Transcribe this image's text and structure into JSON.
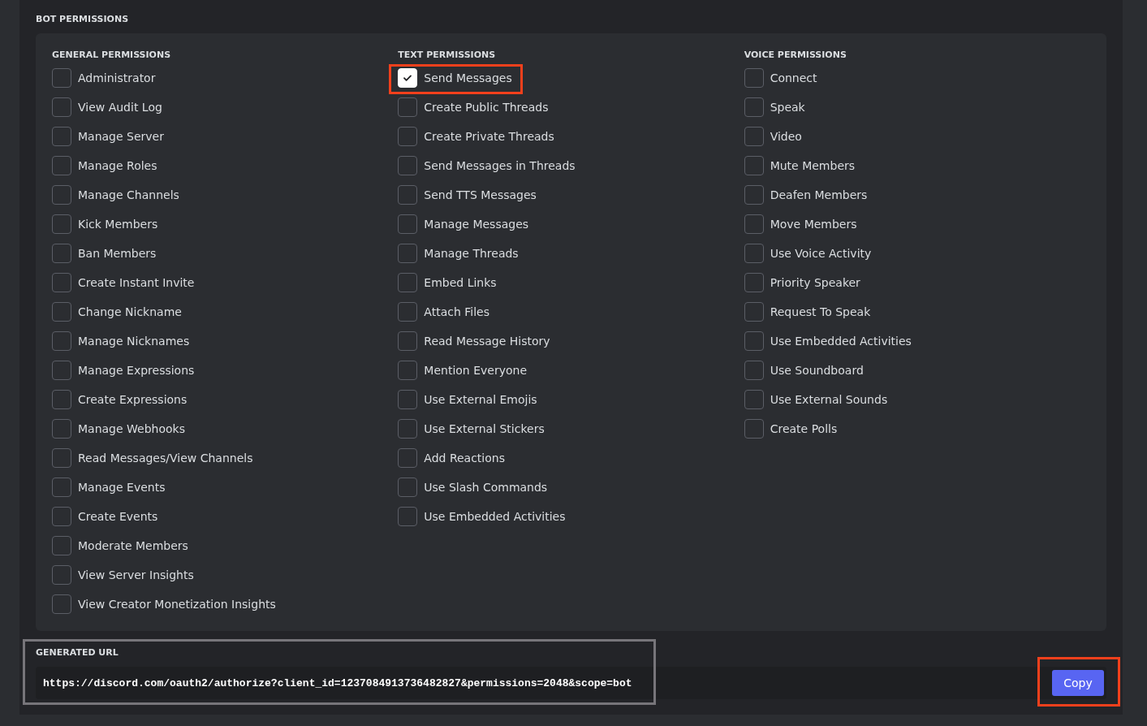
{
  "title": "BOT PERMISSIONS",
  "groups": [
    {
      "heading": "GENERAL PERMISSIONS",
      "permissions": [
        {
          "label": "Administrator",
          "checked": false,
          "highlighted": false
        },
        {
          "label": "View Audit Log",
          "checked": false,
          "highlighted": false
        },
        {
          "label": "Manage Server",
          "checked": false,
          "highlighted": false
        },
        {
          "label": "Manage Roles",
          "checked": false,
          "highlighted": false
        },
        {
          "label": "Manage Channels",
          "checked": false,
          "highlighted": false
        },
        {
          "label": "Kick Members",
          "checked": false,
          "highlighted": false
        },
        {
          "label": "Ban Members",
          "checked": false,
          "highlighted": false
        },
        {
          "label": "Create Instant Invite",
          "checked": false,
          "highlighted": false
        },
        {
          "label": "Change Nickname",
          "checked": false,
          "highlighted": false
        },
        {
          "label": "Manage Nicknames",
          "checked": false,
          "highlighted": false
        },
        {
          "label": "Manage Expressions",
          "checked": false,
          "highlighted": false
        },
        {
          "label": "Create Expressions",
          "checked": false,
          "highlighted": false
        },
        {
          "label": "Manage Webhooks",
          "checked": false,
          "highlighted": false
        },
        {
          "label": "Read Messages/View Channels",
          "checked": false,
          "highlighted": false
        },
        {
          "label": "Manage Events",
          "checked": false,
          "highlighted": false
        },
        {
          "label": "Create Events",
          "checked": false,
          "highlighted": false
        },
        {
          "label": "Moderate Members",
          "checked": false,
          "highlighted": false
        },
        {
          "label": "View Server Insights",
          "checked": false,
          "highlighted": false
        },
        {
          "label": "View Creator Monetization Insights",
          "checked": false,
          "highlighted": false
        }
      ]
    },
    {
      "heading": "TEXT PERMISSIONS",
      "permissions": [
        {
          "label": "Send Messages",
          "checked": true,
          "highlighted": true
        },
        {
          "label": "Create Public Threads",
          "checked": false,
          "highlighted": false
        },
        {
          "label": "Create Private Threads",
          "checked": false,
          "highlighted": false
        },
        {
          "label": "Send Messages in Threads",
          "checked": false,
          "highlighted": false
        },
        {
          "label": "Send TTS Messages",
          "checked": false,
          "highlighted": false
        },
        {
          "label": "Manage Messages",
          "checked": false,
          "highlighted": false
        },
        {
          "label": "Manage Threads",
          "checked": false,
          "highlighted": false
        },
        {
          "label": "Embed Links",
          "checked": false,
          "highlighted": false
        },
        {
          "label": "Attach Files",
          "checked": false,
          "highlighted": false
        },
        {
          "label": "Read Message History",
          "checked": false,
          "highlighted": false
        },
        {
          "label": "Mention Everyone",
          "checked": false,
          "highlighted": false
        },
        {
          "label": "Use External Emojis",
          "checked": false,
          "highlighted": false
        },
        {
          "label": "Use External Stickers",
          "checked": false,
          "highlighted": false
        },
        {
          "label": "Add Reactions",
          "checked": false,
          "highlighted": false
        },
        {
          "label": "Use Slash Commands",
          "checked": false,
          "highlighted": false
        },
        {
          "label": "Use Embedded Activities",
          "checked": false,
          "highlighted": false
        }
      ]
    },
    {
      "heading": "VOICE PERMISSIONS",
      "permissions": [
        {
          "label": "Connect",
          "checked": false,
          "highlighted": false
        },
        {
          "label": "Speak",
          "checked": false,
          "highlighted": false
        },
        {
          "label": "Video",
          "checked": false,
          "highlighted": false
        },
        {
          "label": "Mute Members",
          "checked": false,
          "highlighted": false
        },
        {
          "label": "Deafen Members",
          "checked": false,
          "highlighted": false
        },
        {
          "label": "Move Members",
          "checked": false,
          "highlighted": false
        },
        {
          "label": "Use Voice Activity",
          "checked": false,
          "highlighted": false
        },
        {
          "label": "Priority Speaker",
          "checked": false,
          "highlighted": false
        },
        {
          "label": "Request To Speak",
          "checked": false,
          "highlighted": false
        },
        {
          "label": "Use Embedded Activities",
          "checked": false,
          "highlighted": false
        },
        {
          "label": "Use Soundboard",
          "checked": false,
          "highlighted": false
        },
        {
          "label": "Use External Sounds",
          "checked": false,
          "highlighted": false
        },
        {
          "label": "Create Polls",
          "checked": false,
          "highlighted": false
        }
      ]
    }
  ],
  "generated_url": {
    "heading": "GENERATED URL",
    "value": "https://discord.com/oauth2/authorize?client_id=1237084913736482827&permissions=2048&scope=bot",
    "highlighted": true,
    "copy_button": {
      "label": "Copy",
      "highlighted": true
    }
  }
}
